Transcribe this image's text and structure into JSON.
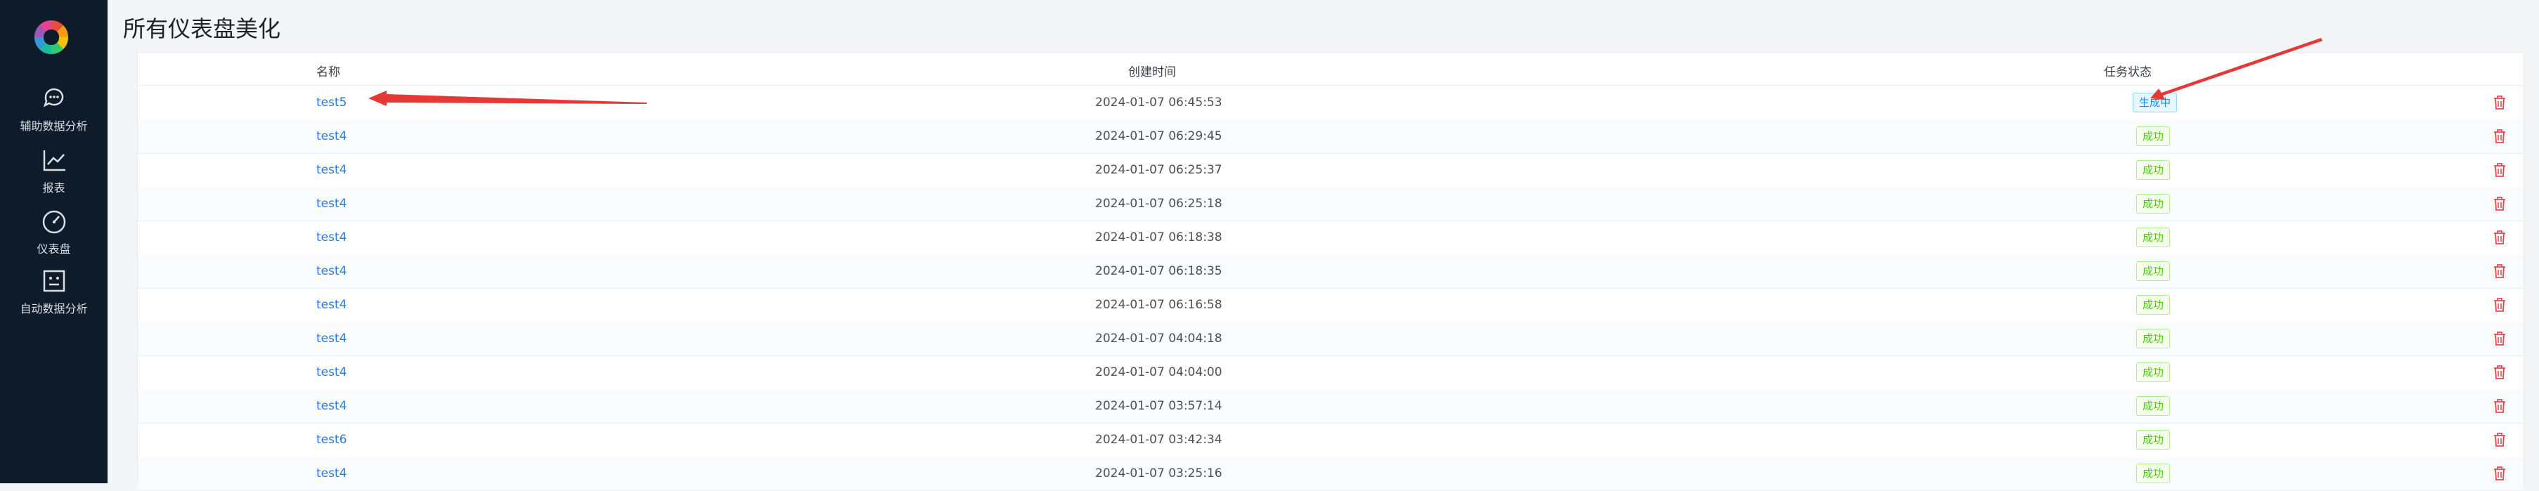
{
  "sidebar": {
    "items": [
      {
        "label": "辅助数据分析",
        "icon": "chat-bubble-icon"
      },
      {
        "label": "报表",
        "icon": "line-chart-icon"
      },
      {
        "label": "仪表盘",
        "icon": "dashboard-gauge-icon"
      },
      {
        "label": "自动数据分析",
        "icon": "robot-face-icon"
      }
    ]
  },
  "page": {
    "title": "所有仪表盘美化"
  },
  "table": {
    "headers": {
      "name": "名称",
      "created": "创建时间",
      "status": "任务状态"
    },
    "rows": [
      {
        "name": "test5",
        "created": "2024-01-07 06:45:53",
        "status": "生成中"
      },
      {
        "name": "test4",
        "created": "2024-01-07 06:29:45",
        "status": "成功"
      },
      {
        "name": "test4",
        "created": "2024-01-07 06:25:37",
        "status": "成功"
      },
      {
        "name": "test4",
        "created": "2024-01-07 06:25:18",
        "status": "成功"
      },
      {
        "name": "test4",
        "created": "2024-01-07 06:18:38",
        "status": "成功"
      },
      {
        "name": "test4",
        "created": "2024-01-07 06:18:35",
        "status": "成功"
      },
      {
        "name": "test4",
        "created": "2024-01-07 06:16:58",
        "status": "成功"
      },
      {
        "name": "test4",
        "created": "2024-01-07 04:04:18",
        "status": "成功"
      },
      {
        "name": "test4",
        "created": "2024-01-07 04:04:00",
        "status": "成功"
      },
      {
        "name": "test4",
        "created": "2024-01-07 03:57:14",
        "status": "成功"
      },
      {
        "name": "test6",
        "created": "2024-01-07 03:42:34",
        "status": "成功"
      },
      {
        "name": "test4",
        "created": "2024-01-07 03:25:16",
        "status": "成功"
      }
    ]
  },
  "colors": {
    "sidebar_bg": "#0e1b2a",
    "link": "#2b7cd3",
    "success": "#52c41a",
    "processing": "#1890ff",
    "delete": "#e5484d",
    "annotation_arrow": "#e53935"
  }
}
